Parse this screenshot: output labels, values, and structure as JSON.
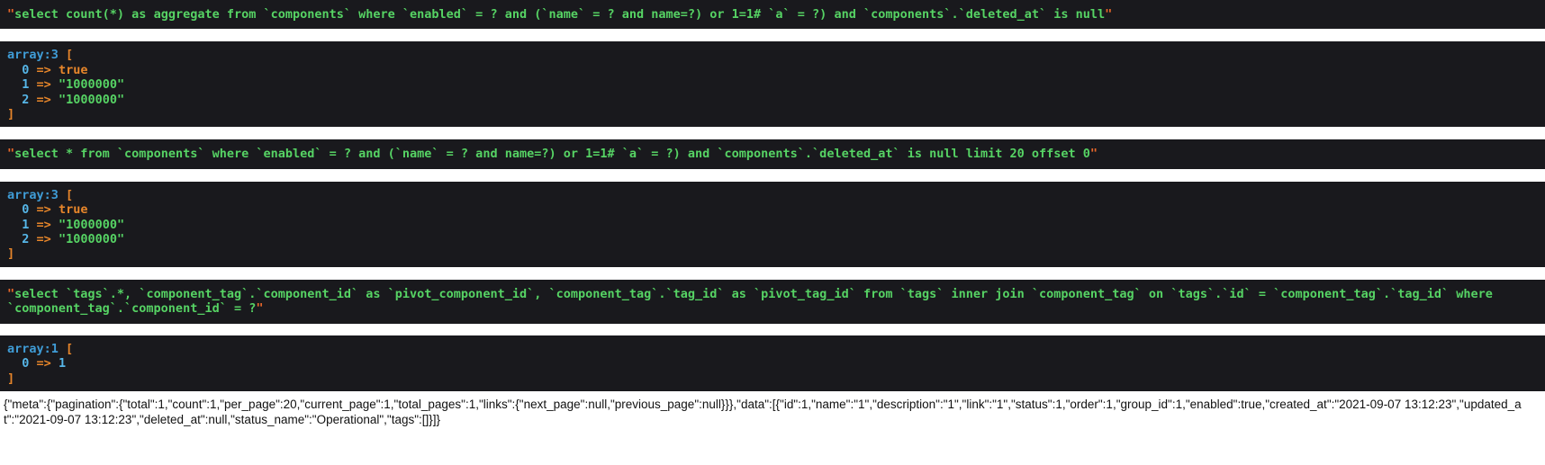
{
  "blocks": {
    "query_1": {
      "open_quote": "\"",
      "sql": "select count(*) as aggregate from `components` where `enabled` = ? and (`name` = ? and name=?) or 1=1# `a` = ?) and `components`.`deleted_at` is null",
      "close_quote": "\""
    },
    "bindings_1": {
      "header_label": "array:3",
      "open_bracket": "[",
      "close_bracket": "]",
      "rows": [
        {
          "index": "0",
          "arrow": "=>",
          "value": "true",
          "kind": "bool"
        },
        {
          "index": "1",
          "arrow": "=>",
          "value": "\"1000000\"",
          "kind": "string"
        },
        {
          "index": "2",
          "arrow": "=>",
          "value": "\"1000000\"",
          "kind": "string"
        }
      ]
    },
    "query_2": {
      "open_quote": "\"",
      "sql": "select * from `components` where `enabled` = ? and (`name` = ? and name=?) or 1=1# `a` = ?) and `components`.`deleted_at` is null limit 20 offset 0",
      "close_quote": "\""
    },
    "bindings_2": {
      "header_label": "array:3",
      "open_bracket": "[",
      "close_bracket": "]",
      "rows": [
        {
          "index": "0",
          "arrow": "=>",
          "value": "true",
          "kind": "bool"
        },
        {
          "index": "1",
          "arrow": "=>",
          "value": "\"1000000\"",
          "kind": "string"
        },
        {
          "index": "2",
          "arrow": "=>",
          "value": "\"1000000\"",
          "kind": "string"
        }
      ]
    },
    "query_3": {
      "open_quote": "\"",
      "sql": "select `tags`.*, `component_tag`.`component_id` as `pivot_component_id`, `component_tag`.`tag_id` as `pivot_tag_id` from `tags` inner join `component_tag` on `tags`.`id` = `component_tag`.`tag_id` where `component_tag`.`component_id` = ?",
      "close_quote": "\""
    },
    "bindings_3": {
      "header_label": "array:1",
      "open_bracket": "[",
      "close_bracket": "]",
      "rows": [
        {
          "index": "0",
          "arrow": "=>",
          "value": "1",
          "kind": "int"
        }
      ]
    },
    "json_response": {
      "text": "{\"meta\":{\"pagination\":{\"total\":1,\"count\":1,\"per_page\":20,\"current_page\":1,\"total_pages\":1,\"links\":{\"next_page\":null,\"previous_page\":null}}},\"data\":[{\"id\":1,\"name\":\"1\",\"description\":\"1\",\"link\":\"1\",\"status\":1,\"order\":1,\"group_id\":1,\"enabled\":true,\"created_at\":\"2021-09-07 13:12:23\",\"updated_at\":\"2021-09-07 13:12:23\",\"deleted_at\":null,\"status_name\":\"Operational\",\"tags\":[]}]}"
    }
  },
  "colors": {
    "dump_background": "#19191d",
    "page_background": "#ffffff",
    "sql_green": "#56d364",
    "quote_orange": "#e8672a",
    "bracket_orange": "#e8862a",
    "index_blue": "#56b6e8",
    "array_label_blue": "#3f9cd6",
    "json_text": "#111111"
  }
}
